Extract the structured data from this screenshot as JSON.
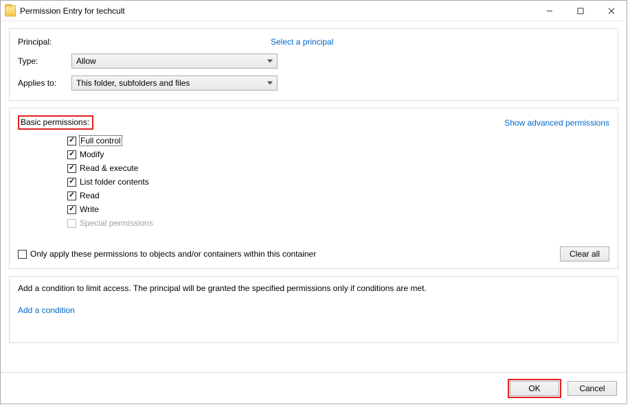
{
  "window": {
    "title": "Permission Entry for techcult"
  },
  "top": {
    "principal_label": "Principal:",
    "select_principal_link": "Select a principal",
    "type_label": "Type:",
    "type_value": "Allow",
    "applies_label": "Applies to:",
    "applies_value": "This folder, subfolders and files"
  },
  "permissions": {
    "header": "Basic permissions:",
    "show_advanced_link": "Show advanced permissions",
    "items": {
      "full_control": "Full control",
      "modify": "Modify",
      "read_execute": "Read & execute",
      "list_folder": "List folder contents",
      "read": "Read",
      "write": "Write",
      "special": "Special permissions"
    },
    "only_apply_label": "Only apply these permissions to objects and/or containers within this container",
    "clear_all_label": "Clear all"
  },
  "conditions": {
    "text": "Add a condition to limit access. The principal will be granted the specified permissions only if conditions are met.",
    "add_link": "Add a condition"
  },
  "footer": {
    "ok_label": "OK",
    "cancel_label": "Cancel"
  }
}
